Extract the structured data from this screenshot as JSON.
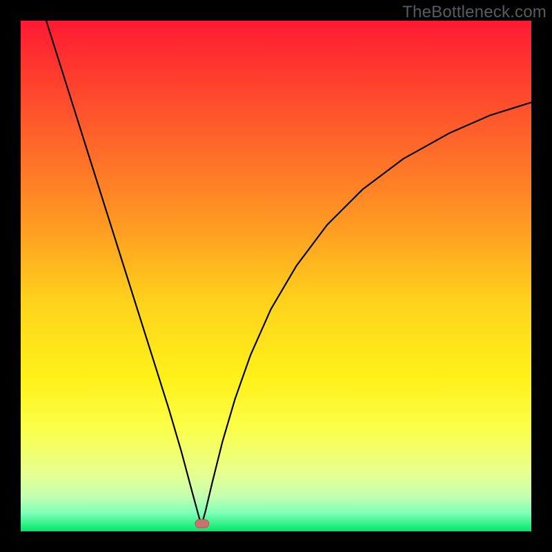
{
  "watermark": "TheBottleneck.com",
  "colors": {
    "curve": "#000000",
    "marker_fill": "#c7736f",
    "marker_stroke": "#b35d58",
    "gradient_stops": [
      {
        "offset": 0.0,
        "color": "#ff1a33"
      },
      {
        "offset": 0.1,
        "color": "#ff3a2f"
      },
      {
        "offset": 0.25,
        "color": "#ff6a2a"
      },
      {
        "offset": 0.4,
        "color": "#ff9a22"
      },
      {
        "offset": 0.55,
        "color": "#ffd21c"
      },
      {
        "offset": 0.7,
        "color": "#fff11a"
      },
      {
        "offset": 0.8,
        "color": "#fbff4a"
      },
      {
        "offset": 0.88,
        "color": "#eaff8a"
      },
      {
        "offset": 0.93,
        "color": "#c6ffb0"
      },
      {
        "offset": 0.965,
        "color": "#7bffb8"
      },
      {
        "offset": 1.0,
        "color": "#00e86a"
      }
    ]
  },
  "chart_data": {
    "type": "line",
    "xlim": [
      0,
      1
    ],
    "ylim": [
      0,
      1
    ],
    "minimum": {
      "x": 0.355,
      "y": 0.015
    },
    "left_branch": [
      {
        "x": 0.05,
        "y": 1.0
      },
      {
        "x": 0.08,
        "y": 0.905
      },
      {
        "x": 0.11,
        "y": 0.81
      },
      {
        "x": 0.14,
        "y": 0.715
      },
      {
        "x": 0.17,
        "y": 0.62
      },
      {
        "x": 0.2,
        "y": 0.525
      },
      {
        "x": 0.23,
        "y": 0.43
      },
      {
        "x": 0.26,
        "y": 0.335
      },
      {
        "x": 0.29,
        "y": 0.24
      },
      {
        "x": 0.315,
        "y": 0.155
      },
      {
        "x": 0.335,
        "y": 0.08
      },
      {
        "x": 0.35,
        "y": 0.025
      },
      {
        "x": 0.355,
        "y": 0.015
      }
    ],
    "right_branch": [
      {
        "x": 0.355,
        "y": 0.015
      },
      {
        "x": 0.362,
        "y": 0.04
      },
      {
        "x": 0.375,
        "y": 0.095
      },
      {
        "x": 0.395,
        "y": 0.175
      },
      {
        "x": 0.42,
        "y": 0.26
      },
      {
        "x": 0.45,
        "y": 0.345
      },
      {
        "x": 0.49,
        "y": 0.435
      },
      {
        "x": 0.54,
        "y": 0.52
      },
      {
        "x": 0.6,
        "y": 0.6
      },
      {
        "x": 0.67,
        "y": 0.67
      },
      {
        "x": 0.75,
        "y": 0.73
      },
      {
        "x": 0.84,
        "y": 0.78
      },
      {
        "x": 0.92,
        "y": 0.815
      },
      {
        "x": 1.0,
        "y": 0.84
      }
    ],
    "title": "",
    "xlabel": "",
    "ylabel": ""
  }
}
